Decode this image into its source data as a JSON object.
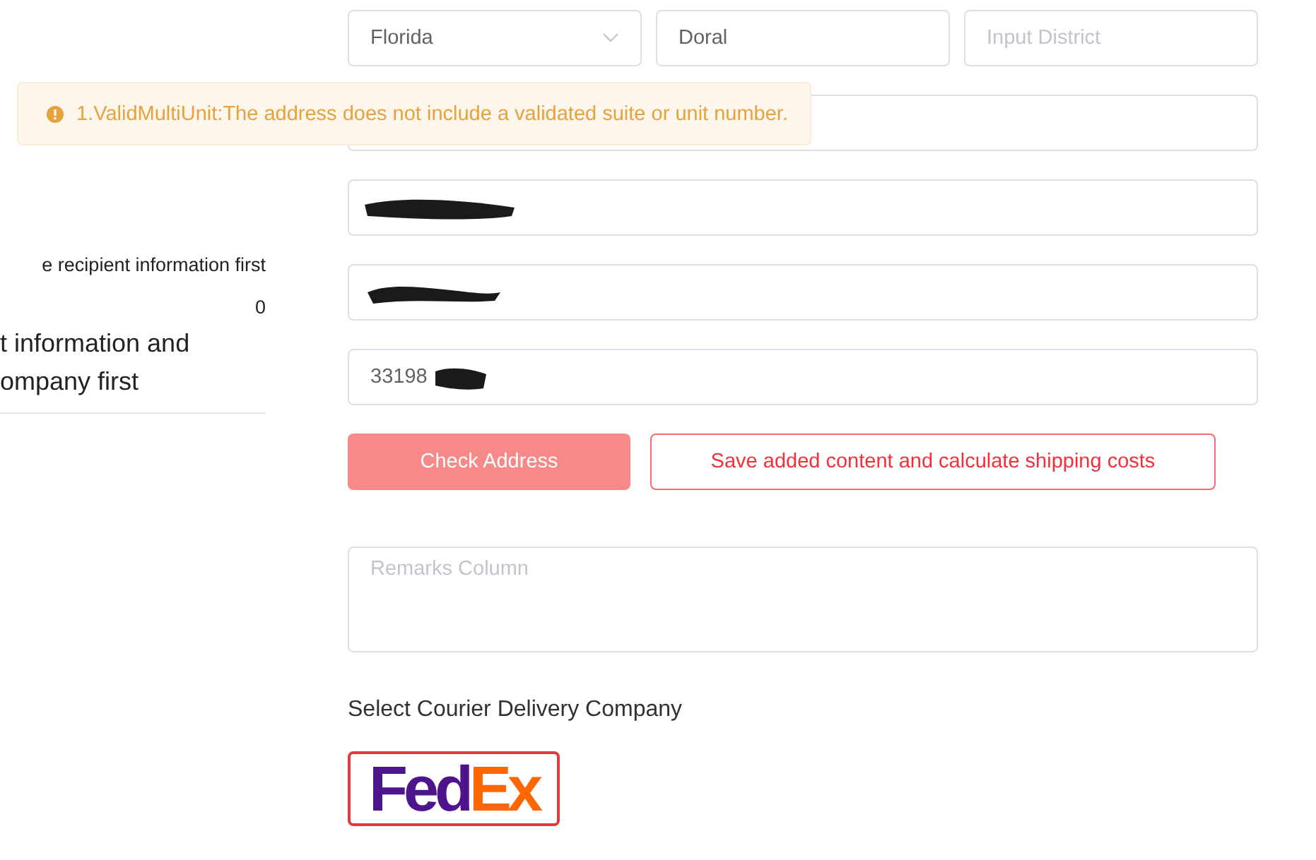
{
  "side_panel": {
    "texts": [
      {
        "kind": "note",
        "text": "e recipient information first"
      },
      {
        "kind": "count",
        "text": "0"
      },
      {
        "kind": "heading",
        "text": "t information and"
      },
      {
        "kind": "heading",
        "text": "ompany first"
      }
    ]
  },
  "address_form": {
    "top_row": [
      {
        "kind": "select",
        "value": "Florida"
      },
      {
        "kind": "input",
        "value": "Doral"
      },
      {
        "kind": "input",
        "placeholder": "Input District"
      }
    ],
    "fields": [
      {
        "redacted": false
      },
      {
        "redacted": true
      },
      {
        "redacted": true
      },
      {
        "value": "33198",
        "redacted": true
      }
    ],
    "buttons": [
      {
        "label": "Check Address",
        "kind": "primary"
      },
      {
        "label": "Save added content and calculate shipping costs",
        "kind": "outline"
      }
    ],
    "remarks": {
      "placeholder": "Remarks Column"
    },
    "courier_label": "Select Courier Delivery Company",
    "couriers": [
      {
        "name_parts": [
          "Fed",
          "Ex"
        ],
        "selected": true
      }
    ]
  },
  "alert": {
    "kind": "warning",
    "text": "1.ValidMultiUnit:The address does not include a validated suite or unit number."
  }
}
